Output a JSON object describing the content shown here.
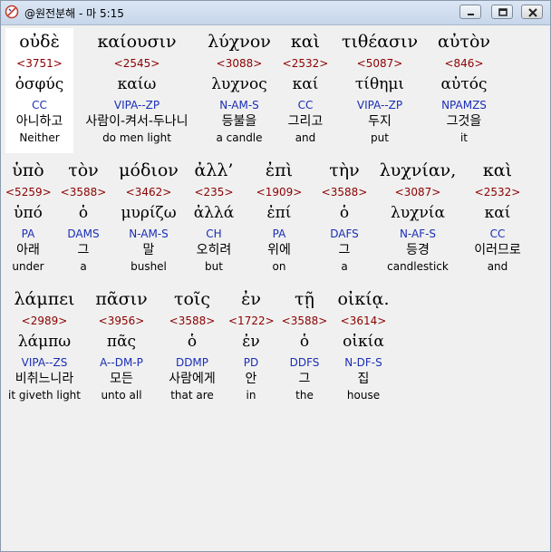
{
  "window": {
    "title": "@원전분해 - 마 5:15"
  },
  "lines": [
    {
      "words": [
        {
          "greek": "οὐδὲ",
          "strong": "<3751>",
          "lemma": "ὀσφύς",
          "morph": "CC",
          "korean": "아니하고",
          "english": "Neither",
          "selected": true
        },
        {
          "greek": "καίουσιν",
          "strong": "<2545>",
          "lemma": "καίω",
          "morph": "VIPA--ZP",
          "korean": "사람이-켜서-두나니",
          "english": "do men light"
        },
        {
          "greek": "λύχνον",
          "strong": "<3088>",
          "lemma": "λυχνος",
          "morph": "N-AM-S",
          "korean": "등불을",
          "english": "a candle"
        },
        {
          "greek": "καὶ",
          "strong": "<2532>",
          "lemma": "καί",
          "morph": "CC",
          "korean": "그리고",
          "english": "and"
        },
        {
          "greek": "τιθέασιν",
          "strong": "<5087>",
          "lemma": "τίθημι",
          "morph": "VIPA--ZP",
          "korean": "두지",
          "english": "put"
        },
        {
          "greek": "αὐτὸν",
          "strong": "<846>",
          "lemma": "αὐτός",
          "morph": "NPAMZS",
          "korean": "그것을",
          "english": "it"
        }
      ]
    },
    {
      "words": [
        {
          "greek": "ὑπὸ",
          "strong": "<5259>",
          "lemma": "ὑπό",
          "morph": "PA",
          "korean": "아래",
          "english": "under"
        },
        {
          "greek": "τὸν",
          "strong": "<3588>",
          "lemma": "ὁ",
          "morph": "DAMS",
          "korean": "그",
          "english": "a"
        },
        {
          "greek": "μόδιον",
          "strong": "<3462>",
          "lemma": "μυρίζω",
          "morph": "N-AM-S",
          "korean": "말",
          "english": "bushel"
        },
        {
          "greek": "ἀλλ’",
          "strong": "<235>",
          "lemma": "ἀλλά",
          "morph": "CH",
          "korean": "오히려",
          "english": "but"
        },
        {
          "greek": "ἐπὶ",
          "strong": "<1909>",
          "lemma": "ἐπί",
          "morph": "PA",
          "korean": "위에",
          "english": "on"
        },
        {
          "greek": "τὴν",
          "strong": "<3588>",
          "lemma": "ὁ",
          "morph": "DAFS",
          "korean": "그",
          "english": "a"
        },
        {
          "greek": "λυχνίαν,",
          "strong": "<3087>",
          "lemma": "λυχνία",
          "morph": "N-AF-S",
          "korean": "등경",
          "english": "candlestick"
        },
        {
          "greek": "καὶ",
          "strong": "<2532>",
          "lemma": "καί",
          "morph": "CC",
          "korean": "이러므로",
          "english": "and"
        }
      ]
    },
    {
      "words": [
        {
          "greek": "λάμπει",
          "strong": "<2989>",
          "lemma": "λάμπω",
          "morph": "VIPA--ZS",
          "korean": "비취느니라",
          "english": "it giveth light"
        },
        {
          "greek": "πᾶσιν",
          "strong": "<3956>",
          "lemma": "πᾶς",
          "morph": "A--DM-P",
          "korean": "모든",
          "english": "unto all"
        },
        {
          "greek": "τοῖς",
          "strong": "<3588>",
          "lemma": "ὁ",
          "morph": "DDMP",
          "korean": "사람에게",
          "english": "that are"
        },
        {
          "greek": "ἐν",
          "strong": "<1722>",
          "lemma": "ἐν",
          "morph": "PD",
          "korean": "안",
          "english": "in"
        },
        {
          "greek": "τῇ",
          "strong": "<3588>",
          "lemma": "ὁ",
          "morph": "DDFS",
          "korean": "그",
          "english": "the"
        },
        {
          "greek": "οἰκίᾳ.",
          "strong": "<3614>",
          "lemma": "οἰκία",
          "morph": "N-DF-S",
          "korean": "집",
          "english": "house"
        }
      ]
    }
  ]
}
